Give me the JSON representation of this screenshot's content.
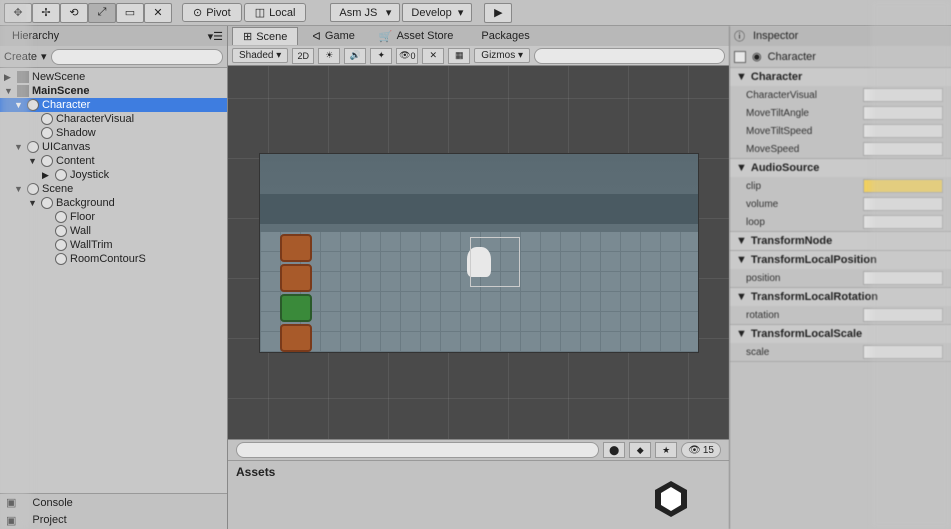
{
  "toolbar": {
    "pivot_label": "Pivot",
    "local_label": "Local",
    "platform_dropdown": "Asm JS",
    "build_dropdown": "Develop"
  },
  "hierarchy": {
    "tab_label": "Hierarchy",
    "create_label": "Create",
    "items": [
      {
        "label": "NewScene",
        "fold": "▶",
        "icon": "cube"
      },
      {
        "label": "MainScene",
        "fold": "▼",
        "icon": "cube",
        "bold": true
      },
      {
        "label": "Character",
        "fold": "▼",
        "icon": "circle",
        "indent": 1,
        "selected": true
      },
      {
        "label": "CharacterVisual",
        "icon": "circle",
        "indent": 2
      },
      {
        "label": "Shadow",
        "icon": "circle",
        "indent": 2
      },
      {
        "label": "UICanvas",
        "fold": "▼",
        "icon": "circle",
        "indent": 1
      },
      {
        "label": "Content",
        "fold": "▼",
        "icon": "circle",
        "indent": 2
      },
      {
        "label": "Joystick",
        "fold": "▶",
        "icon": "circle",
        "indent": 3
      },
      {
        "label": "Scene",
        "fold": "▼",
        "icon": "circle",
        "indent": 1
      },
      {
        "label": "Background",
        "fold": "▼",
        "icon": "circle",
        "indent": 2
      },
      {
        "label": "Floor",
        "icon": "circle",
        "indent": 3
      },
      {
        "label": "Wall",
        "icon": "circle",
        "indent": 3
      },
      {
        "label": "WallTrim",
        "icon": "circle",
        "indent": 3
      },
      {
        "label": "RoomContourS",
        "icon": "circle",
        "indent": 3
      }
    ]
  },
  "scene": {
    "tabs": [
      {
        "label": "Scene",
        "active": true
      },
      {
        "label": "Game"
      },
      {
        "label": "Asset Store"
      },
      {
        "label": "Packages"
      }
    ],
    "shading_mode": "Shaded",
    "view_2d": "2D",
    "gizmos_label": "Gizmos",
    "layer_count": "0"
  },
  "bottom": {
    "console_tab": "Console",
    "project_tab": "Project",
    "assets_label": "Assets",
    "counter": "15"
  },
  "inspector": {
    "tab_label": "Inspector",
    "object_name": "Character",
    "components": [
      {
        "name": "Character",
        "props": [
          {
            "label": "CharacterVisual",
            "value": ""
          },
          {
            "label": "MoveTiltAngle",
            "value": ""
          },
          {
            "label": "MoveTiltSpeed",
            "value": ""
          },
          {
            "label": "MoveSpeed",
            "value": ""
          }
        ]
      },
      {
        "name": "AudioSource",
        "props": [
          {
            "label": "clip",
            "value": "",
            "yellow": true
          },
          {
            "label": "volume",
            "value": ""
          },
          {
            "label": "loop",
            "value": ""
          }
        ]
      },
      {
        "name": "TransformNode",
        "props": []
      },
      {
        "name": "TransformLocalPosition",
        "props": [
          {
            "label": "position",
            "value": ""
          }
        ]
      },
      {
        "name": "TransformLocalRotation",
        "props": [
          {
            "label": "rotation",
            "value": ""
          }
        ]
      },
      {
        "name": "TransformLocalScale",
        "props": [
          {
            "label": "scale",
            "value": ""
          }
        ]
      }
    ]
  }
}
